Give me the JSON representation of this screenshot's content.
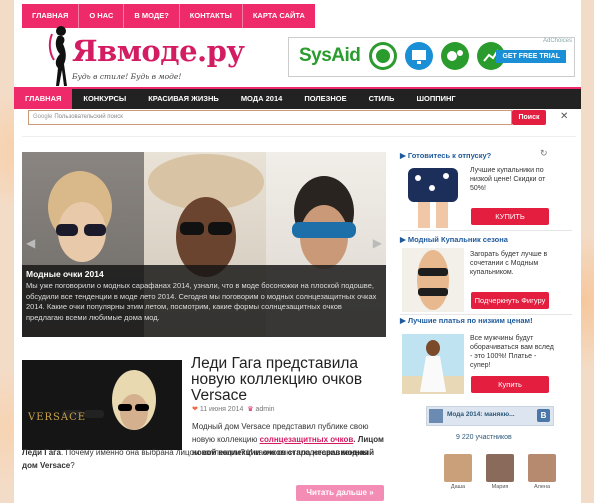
{
  "top_nav": [
    "ГЛАВНАЯ",
    "О НАС",
    "В МОДЕ?",
    "КОНТАКТЫ",
    "КАРТА САЙТА"
  ],
  "logo": {
    "title": "Явмоде.ру",
    "tagline": "Будь в стиле! Будь в моде!"
  },
  "ad": {
    "choices": "AdChoices",
    "brand": "SysAid",
    "cta": "GET FREE TRIAL"
  },
  "main_nav": [
    "ГЛАВНАЯ",
    "КОНКУРСЫ",
    "КРАСИВАЯ ЖИЗНЬ",
    "МОДА 2014",
    "ПОЛЕЗНОЕ",
    "СТИЛЬ",
    "ШОППИНГ"
  ],
  "search": {
    "google": "Google",
    "placeholder": "Пользовательский поиск",
    "button": "Поиск"
  },
  "slider": {
    "caption_title": "Модные очки 2014",
    "caption_text": "Мы уже поговорили о модных сарафанах 2014, узнали, что в моде босоножки на плоской подошве, обсудили все тенденции в моде лето 2014. Сегодня мы поговорим о модных солнцезащитных очках 2014. Какие очки популярны этим летом, посмотрим, какие формы солнцезащитных очков предлагаю всеми любимые дома мод."
  },
  "article": {
    "thumb_brand": "VERSACE",
    "title": "Леди Гага представила новую коллекцию очков Versace",
    "date": "11 июня 2014",
    "author": "admin",
    "text_a": "Модный дом Versace представил публике свою новую коллекцию ",
    "text_link": "солнцезащитных очков",
    "text_b": ". Лицом новой коллекции очков стала несравненная ",
    "text_c": "Леди Гага",
    "text_d": ". Почему именно она выбрана лицом коллекции? И какие очки представил ",
    "text_e": "модный дом Versace",
    "text_f": "?",
    "read_more": "Читать дальше »"
  },
  "sidebar": {
    "w1": {
      "title": "Готовитесь к отпуску?",
      "text": "Лучшие купальники по низкой цене! Скидки от 50%!",
      "button": "КУПИТЬ"
    },
    "w2": {
      "title": "Модный Купальник сезона",
      "text": "Загорать будет лучше в сочетании с Модным купальником.",
      "button": "Подчеркнуть Фигуру"
    },
    "w3": {
      "title": "Лучшие платья по низким ценам!",
      "text": "Все мужчины будут оборачиваться вам вслед - это 100%! Платье - супер!",
      "button": "Купить"
    },
    "vk": {
      "group": "Мода 2014: манякю...",
      "members": "9 220 участников",
      "people": [
        "Даша",
        "Мария",
        "Алена"
      ]
    }
  },
  "colors": {
    "accent": "#ee2a6a",
    "nav_dark": "#222222",
    "sidebar_blue": "#1e5a9b",
    "button_red": "#e41e3f"
  }
}
